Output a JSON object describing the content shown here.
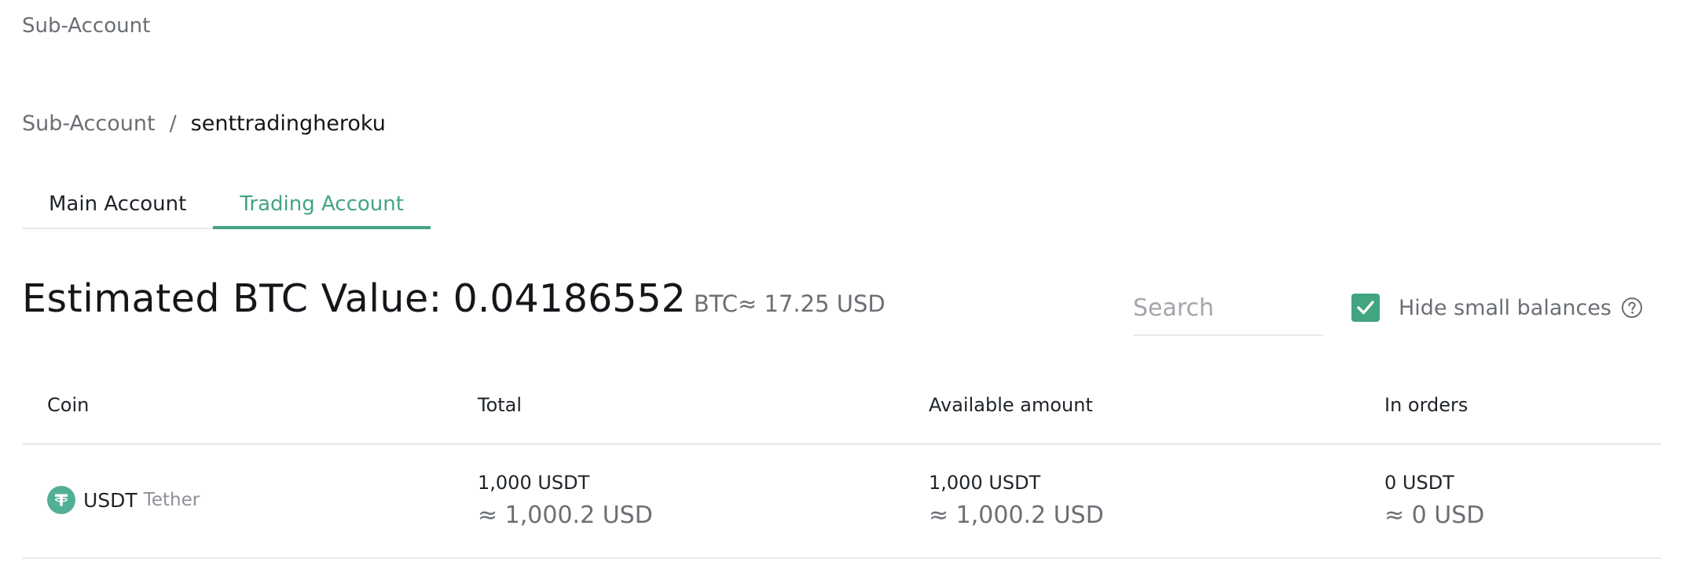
{
  "header": {
    "title": "Sub-Account"
  },
  "breadcrumb": {
    "root": "Sub-Account",
    "separator": "/",
    "current": "senttradingheroku"
  },
  "tabs": [
    {
      "label": "Main Account",
      "active": false
    },
    {
      "label": "Trading Account",
      "active": true
    }
  ],
  "summary": {
    "label": "Estimated BTC Value:",
    "btc_value": "0.04186552",
    "btc_unit": "BTC",
    "usd_value": "≈ 17.25 USD"
  },
  "search": {
    "placeholder": "Search",
    "value": ""
  },
  "hide_small": {
    "label": "Hide small balances",
    "checked": true
  },
  "table": {
    "columns": [
      "Coin",
      "Total",
      "Available amount",
      "In orders"
    ],
    "rows": [
      {
        "symbol": "USDT",
        "name": "Tether",
        "total": "1,000 USDT",
        "total_usd": "≈ 1,000.2 USD",
        "available": "1,000 USDT",
        "available_usd": "≈ 1,000.2 USD",
        "in_orders": "0 USDT",
        "in_orders_usd": "≈ 0 USD"
      }
    ]
  },
  "colors": {
    "accent": "#42a57f",
    "tether": "#50af95",
    "text_primary": "#1e2329",
    "text_secondary": "#6b6f74",
    "border": "#eaecef"
  },
  "icons": {
    "checkbox": "checkmark-icon",
    "help": "question-circle-icon",
    "coin": "tether-logo-icon"
  }
}
